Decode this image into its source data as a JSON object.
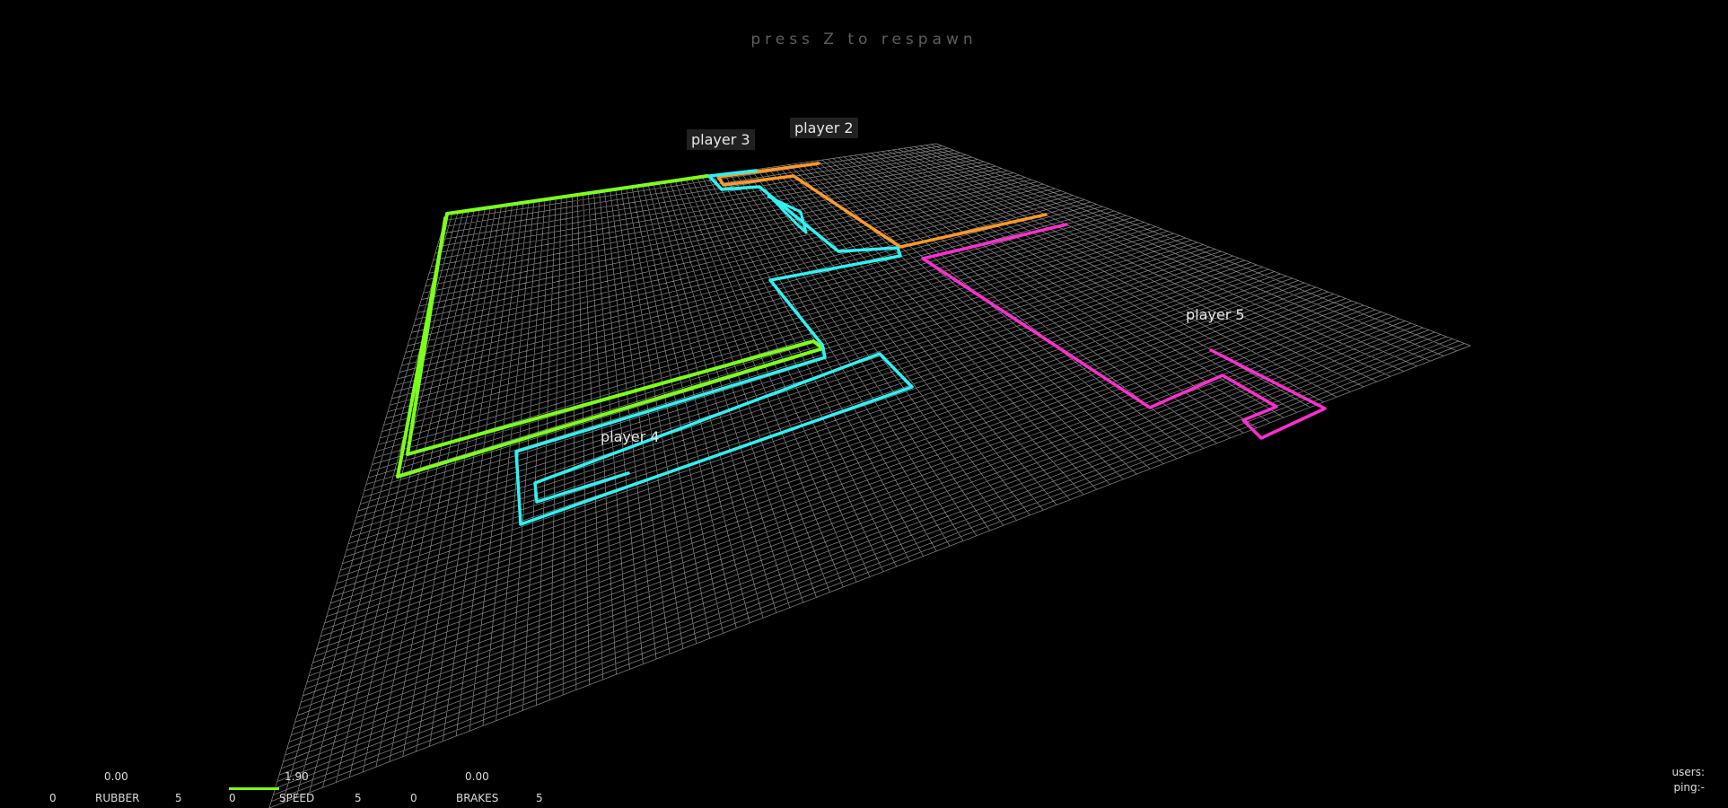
{
  "hint": "press Z to respawn",
  "colors": {
    "background": "#000000",
    "grid": "#8a8a8a",
    "player1": "#7cff1a",
    "player2": "#ff9a2a",
    "player3": "#2ef2f2",
    "player4": "#2ef2f2",
    "player5": "#ff2ed0"
  },
  "players": [
    {
      "id": "p3",
      "name": "player 3"
    },
    {
      "id": "p2",
      "name": "player 2"
    },
    {
      "id": "p5",
      "name": "player 5"
    },
    {
      "id": "p4",
      "name": "player 4"
    }
  ],
  "hud": {
    "rubber": {
      "label": "RUBBER",
      "value": "0.00",
      "min": "0",
      "max": "5",
      "level": 0.0
    },
    "speed": {
      "label": "SPEED",
      "value": "1.90",
      "min": "0",
      "max": "5",
      "level": 0.38
    },
    "brakes": {
      "label": "BRAKES",
      "value": "0.00",
      "min": "0",
      "max": "5",
      "level": 0.0
    }
  },
  "net": {
    "users": "users:",
    "ping": "ping:-"
  }
}
